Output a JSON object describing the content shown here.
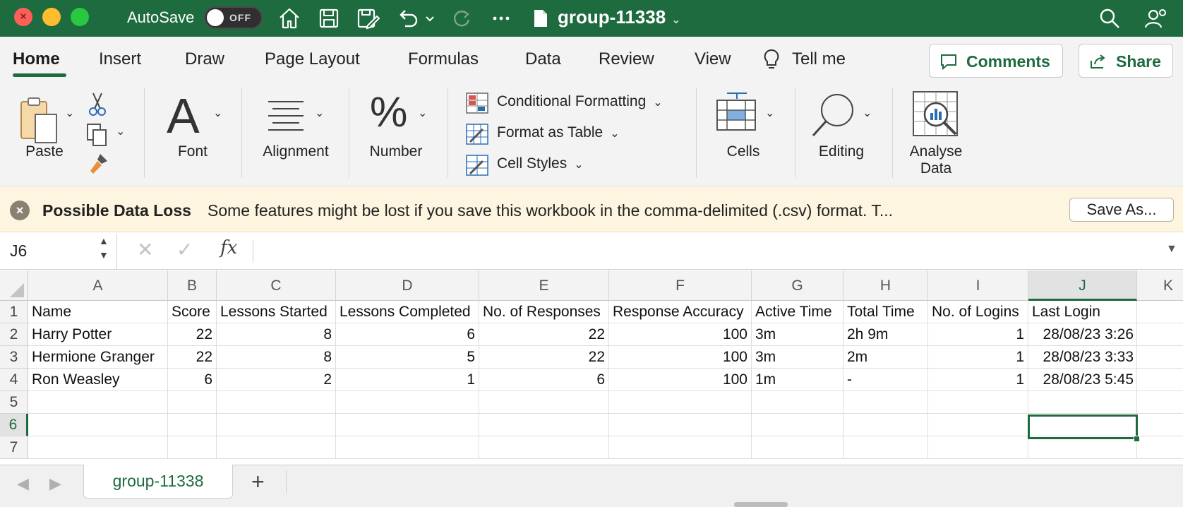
{
  "window": {
    "autosave_label": "AutoSave",
    "autosave_state": "OFF",
    "doc_title": "group-11338"
  },
  "ribbon_tabs": [
    "Home",
    "Insert",
    "Draw",
    "Page Layout",
    "Formulas",
    "Data",
    "Review",
    "View",
    "Tell me"
  ],
  "buttons": {
    "comments": "Comments",
    "share": "Share"
  },
  "ribbon": {
    "paste": "Paste",
    "font": "Font",
    "alignment": "Alignment",
    "number": "Number",
    "number_glyph": "%",
    "conditional_formatting": "Conditional Formatting",
    "format_as_table": "Format as Table",
    "cell_styles": "Cell Styles",
    "cells": "Cells",
    "editing": "Editing",
    "analyse_line1": "Analyse",
    "analyse_line2": "Data"
  },
  "message_bar": {
    "title": "Possible Data Loss",
    "text": "Some features might be lost if you save this workbook in the comma-delimited (.csv) format. T...",
    "save_as": "Save As..."
  },
  "formula_bar": {
    "name_box": "J6",
    "fx": "fx",
    "value": ""
  },
  "sheet": {
    "columns": [
      "A",
      "B",
      "C",
      "D",
      "E",
      "F",
      "G",
      "H",
      "I",
      "J",
      "K"
    ],
    "selected_column": "J",
    "rows": [
      "1",
      "2",
      "3",
      "4",
      "5",
      "6",
      "7"
    ],
    "selected_row": "6",
    "headers": [
      "Name",
      "Score",
      "Lessons Started",
      "Lessons Completed",
      "No. of Responses",
      "Response Accuracy",
      "Active Time",
      "Total Time",
      "No. of Logins",
      "Last Login"
    ],
    "data": [
      [
        "Harry Potter",
        "22",
        "8",
        "6",
        "22",
        "100",
        "3m",
        "2h 9m",
        "1",
        "28/08/23 3:26"
      ],
      [
        "Hermione Granger",
        "22",
        "8",
        "5",
        "22",
        "100",
        "3m",
        "2m",
        "1",
        "28/08/23 3:33"
      ],
      [
        "Ron Weasley",
        "6",
        "2",
        "1",
        "6",
        "100",
        "1m",
        "-",
        "1",
        "28/08/23 5:45"
      ]
    ],
    "selected_cell": "J6"
  },
  "sheet_tabs": [
    "group-11338"
  ],
  "colors": {
    "accent": "#1e6b3f",
    "message_bar": "#fdf5df"
  }
}
